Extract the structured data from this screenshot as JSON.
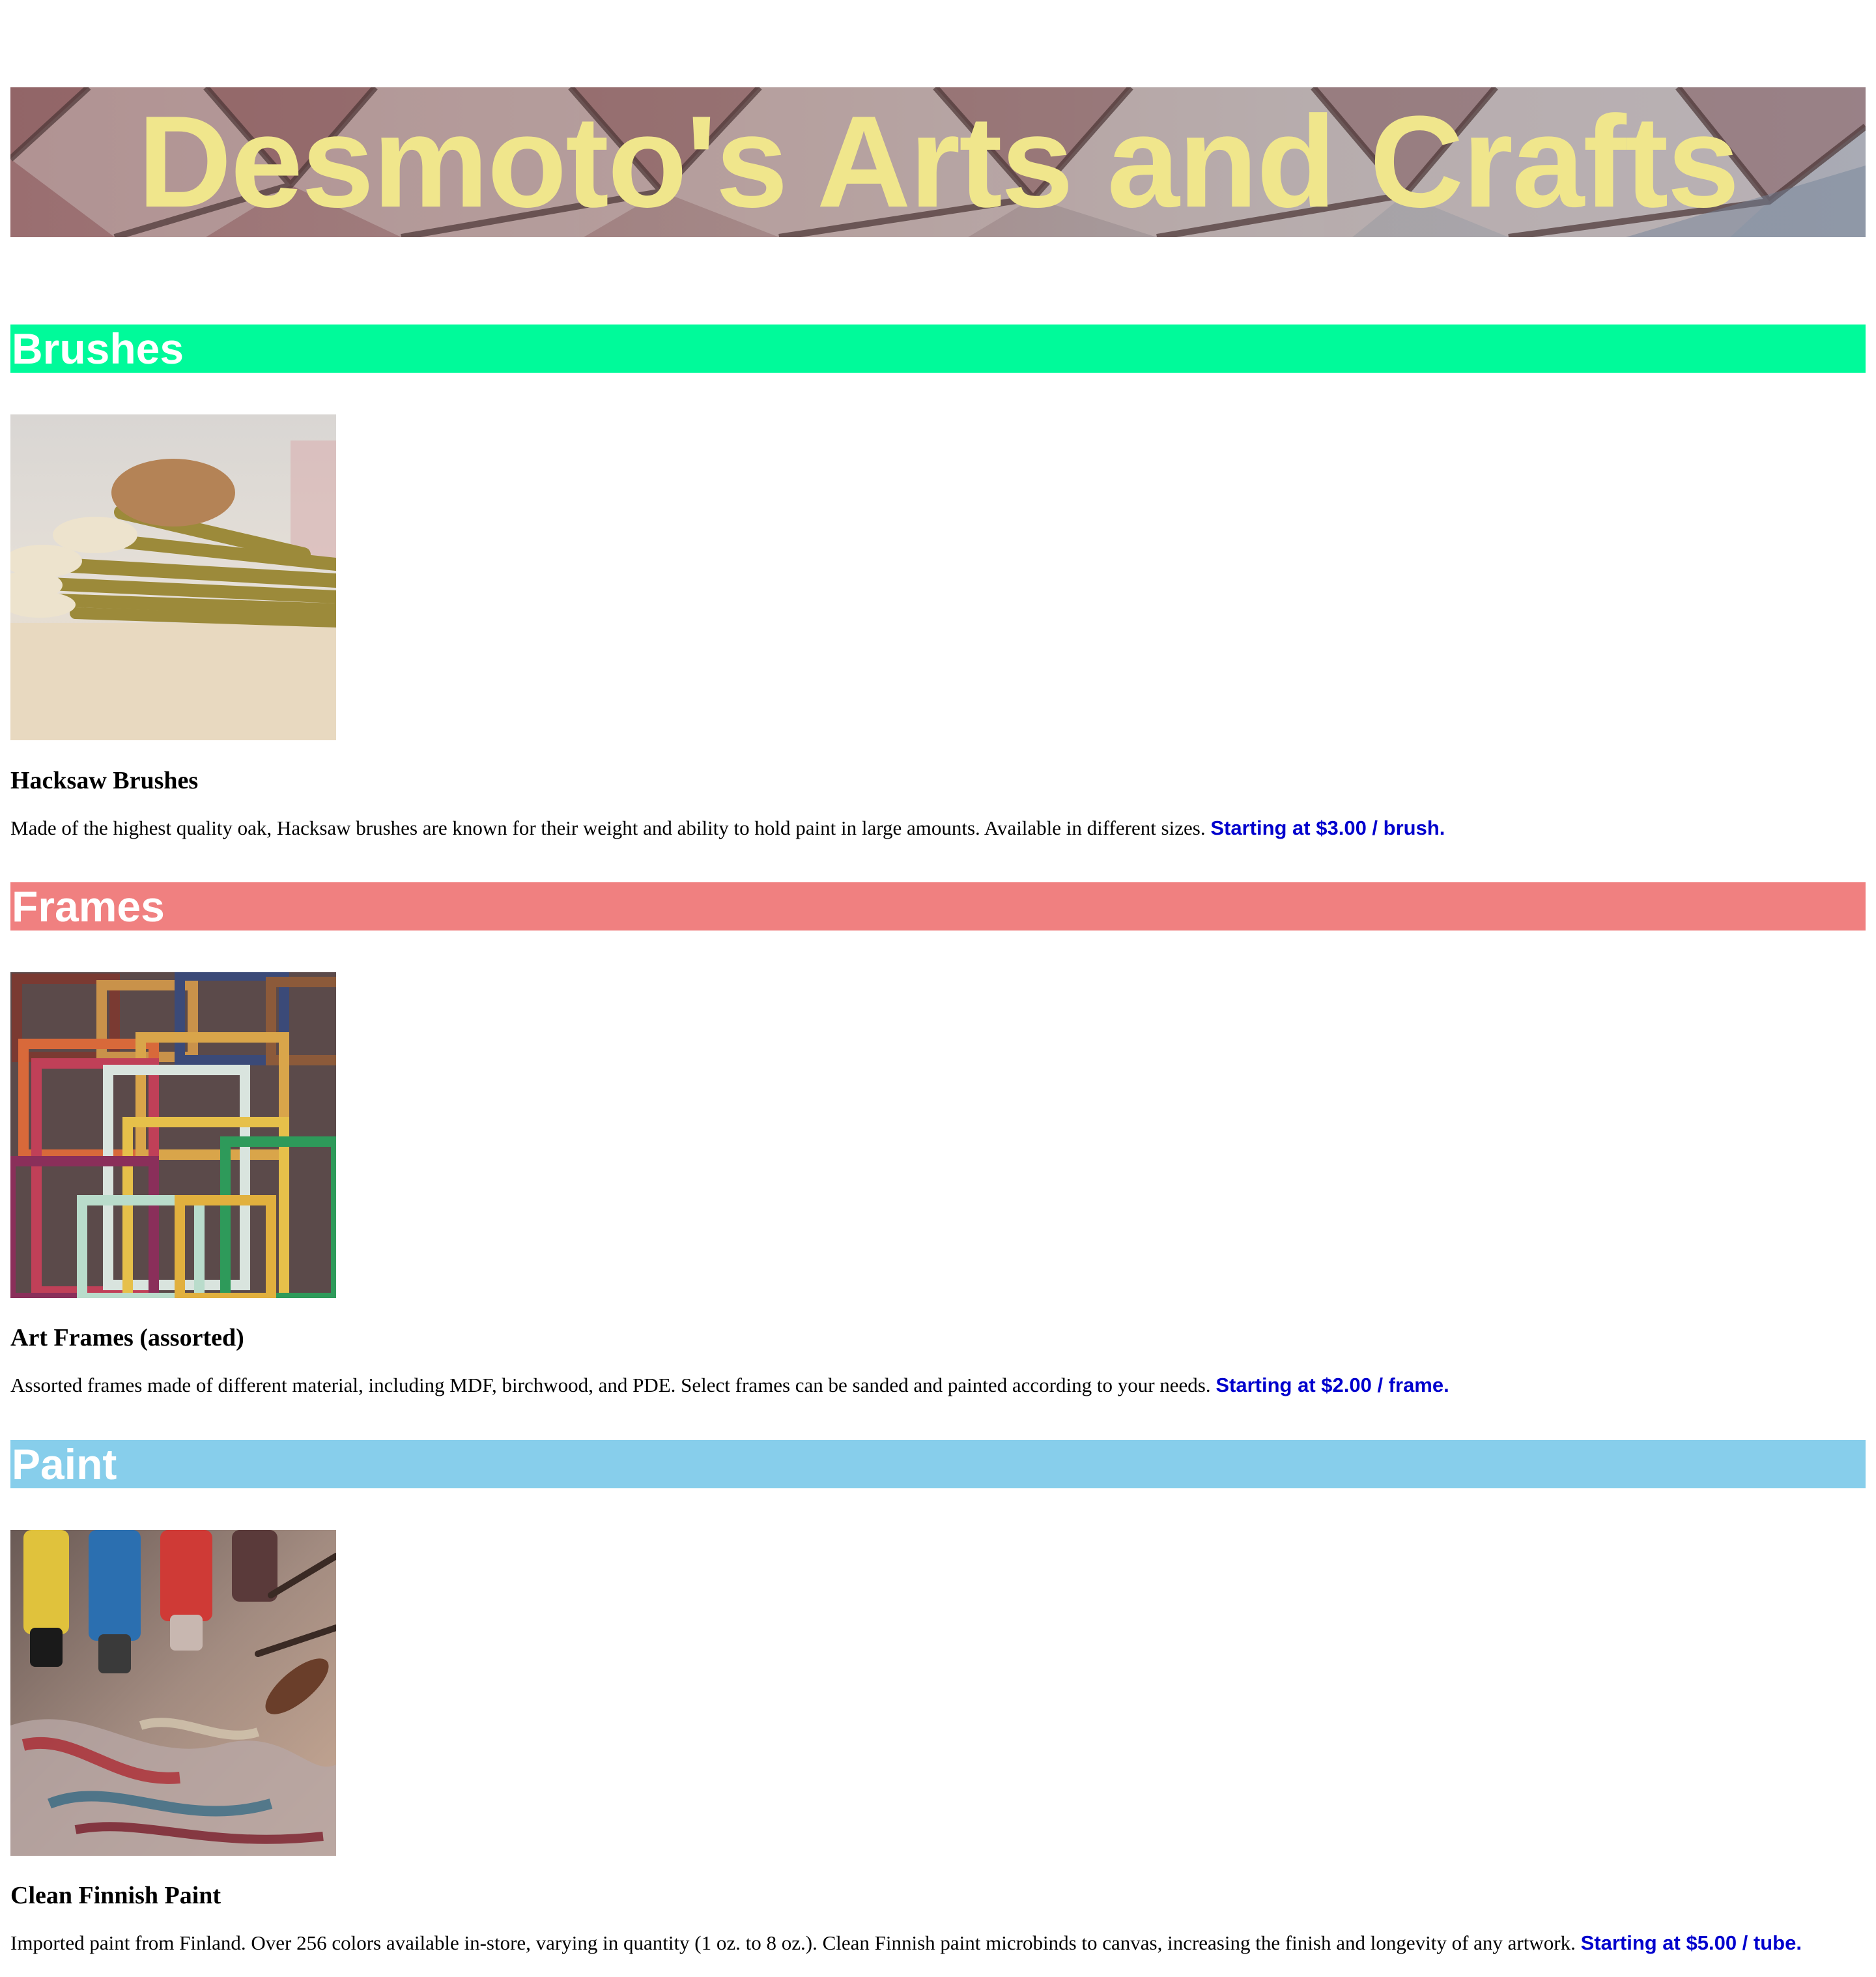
{
  "header": {
    "title": "Desmoto's Arts and Crafts",
    "title_color": "#f0e68c"
  },
  "sections": [
    {
      "heading": "Brushes",
      "heading_bg": "#00fa9a",
      "image_icon": "brushes-photo",
      "product": {
        "name": "Hacksaw Brushes",
        "description": "Made of the highest quality oak, Hacksaw brushes are known for their weight and ability to hold paint in large amounts. Available in different sizes.",
        "price": "Starting at $3.00 / brush."
      }
    },
    {
      "heading": "Frames",
      "heading_bg": "#f08080",
      "image_icon": "frames-photo",
      "product": {
        "name": "Art Frames (assorted)",
        "description": "Assorted frames made of different material, including MDF, birchwood, and PDE. Select frames can be sanded and painted according to your needs.",
        "price": "Starting at $2.00 / frame."
      }
    },
    {
      "heading": "Paint",
      "heading_bg": "#87ceeb",
      "image_icon": "paint-photo",
      "product": {
        "name": "Clean Finnish Paint",
        "description": "Imported paint from Finland. Over 256 colors available in-store, varying in quantity (1 oz. to 8 oz.). Clean Finnish paint microbinds to canvas, increasing the finish and longevity of any artwork.",
        "price": "Starting at $5.00 / tube."
      }
    }
  ],
  "colors": {
    "price": "#0000cd",
    "heading_text": "#ffffff"
  }
}
